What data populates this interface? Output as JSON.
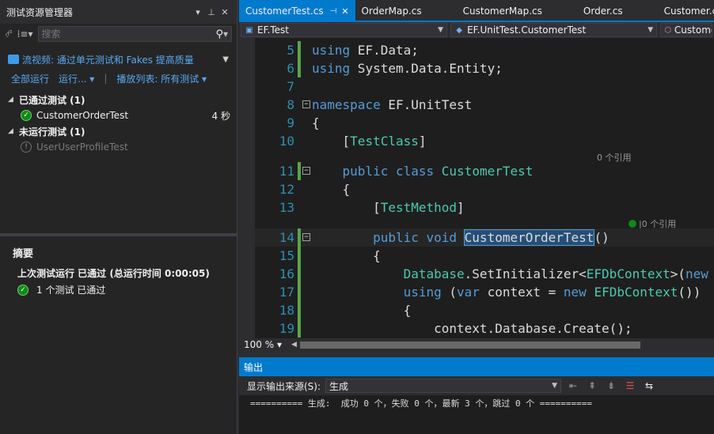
{
  "test_explorer": {
    "title": "测试资源管理器",
    "title_controls": [
      "▾",
      "⊥",
      "✕"
    ],
    "search_placeholder": "搜索",
    "promo_link": "流视频: 通过单元测试和 Fakes 提高质量",
    "actions": {
      "run_all": "全部运行",
      "run": "运行...",
      "playlist": "播放列表: 所有测试"
    },
    "groups": [
      {
        "label": "已通过测试 (1)",
        "tests": [
          {
            "name": "CustomerOrderTest",
            "duration": "4 秒",
            "status": "passed"
          }
        ]
      },
      {
        "label": "未运行测试 (1)",
        "tests": [
          {
            "name": "UserUserProfileTest",
            "duration": "",
            "status": "not-run"
          }
        ]
      }
    ],
    "summary": {
      "heading": "摘要",
      "last_run": "上次测试运行 已通过 (总运行时间 0:00:05)",
      "result": "1 个测试 已通过"
    }
  },
  "editor": {
    "tabs": [
      {
        "label": "CustomerTest.cs",
        "active": true
      },
      {
        "label": "OrderMap.cs",
        "active": false
      },
      {
        "label": "CustomerMap.cs",
        "active": false
      },
      {
        "label": "Order.cs",
        "active": false
      },
      {
        "label": "Customer.cs",
        "active": false
      }
    ],
    "navbar": {
      "project": "EF.Test",
      "class": "EF.UnitTest.CustomerTest",
      "member": "Custome"
    },
    "references": {
      "class": "0 个引用",
      "method": "0 个引用"
    },
    "line_numbers": [
      "5",
      "6",
      "7",
      "8",
      "9",
      "10",
      "11",
      "12",
      "13",
      "14",
      "15",
      "16",
      "17",
      "18",
      "19"
    ],
    "zoom": "100 %"
  },
  "output": {
    "title": "输出",
    "source_label": "显示输出来源(S):",
    "source_value": "生成",
    "text": "========== 生成:  成功 0 个，失败 0 个，最新 3 个，跳过 0 个 =========="
  },
  "colors": {
    "accent": "#007acc",
    "keyword": "#569cd6",
    "type": "#4ec9b0",
    "link": "#5aa9f0",
    "change_bar": "#57a64a"
  }
}
